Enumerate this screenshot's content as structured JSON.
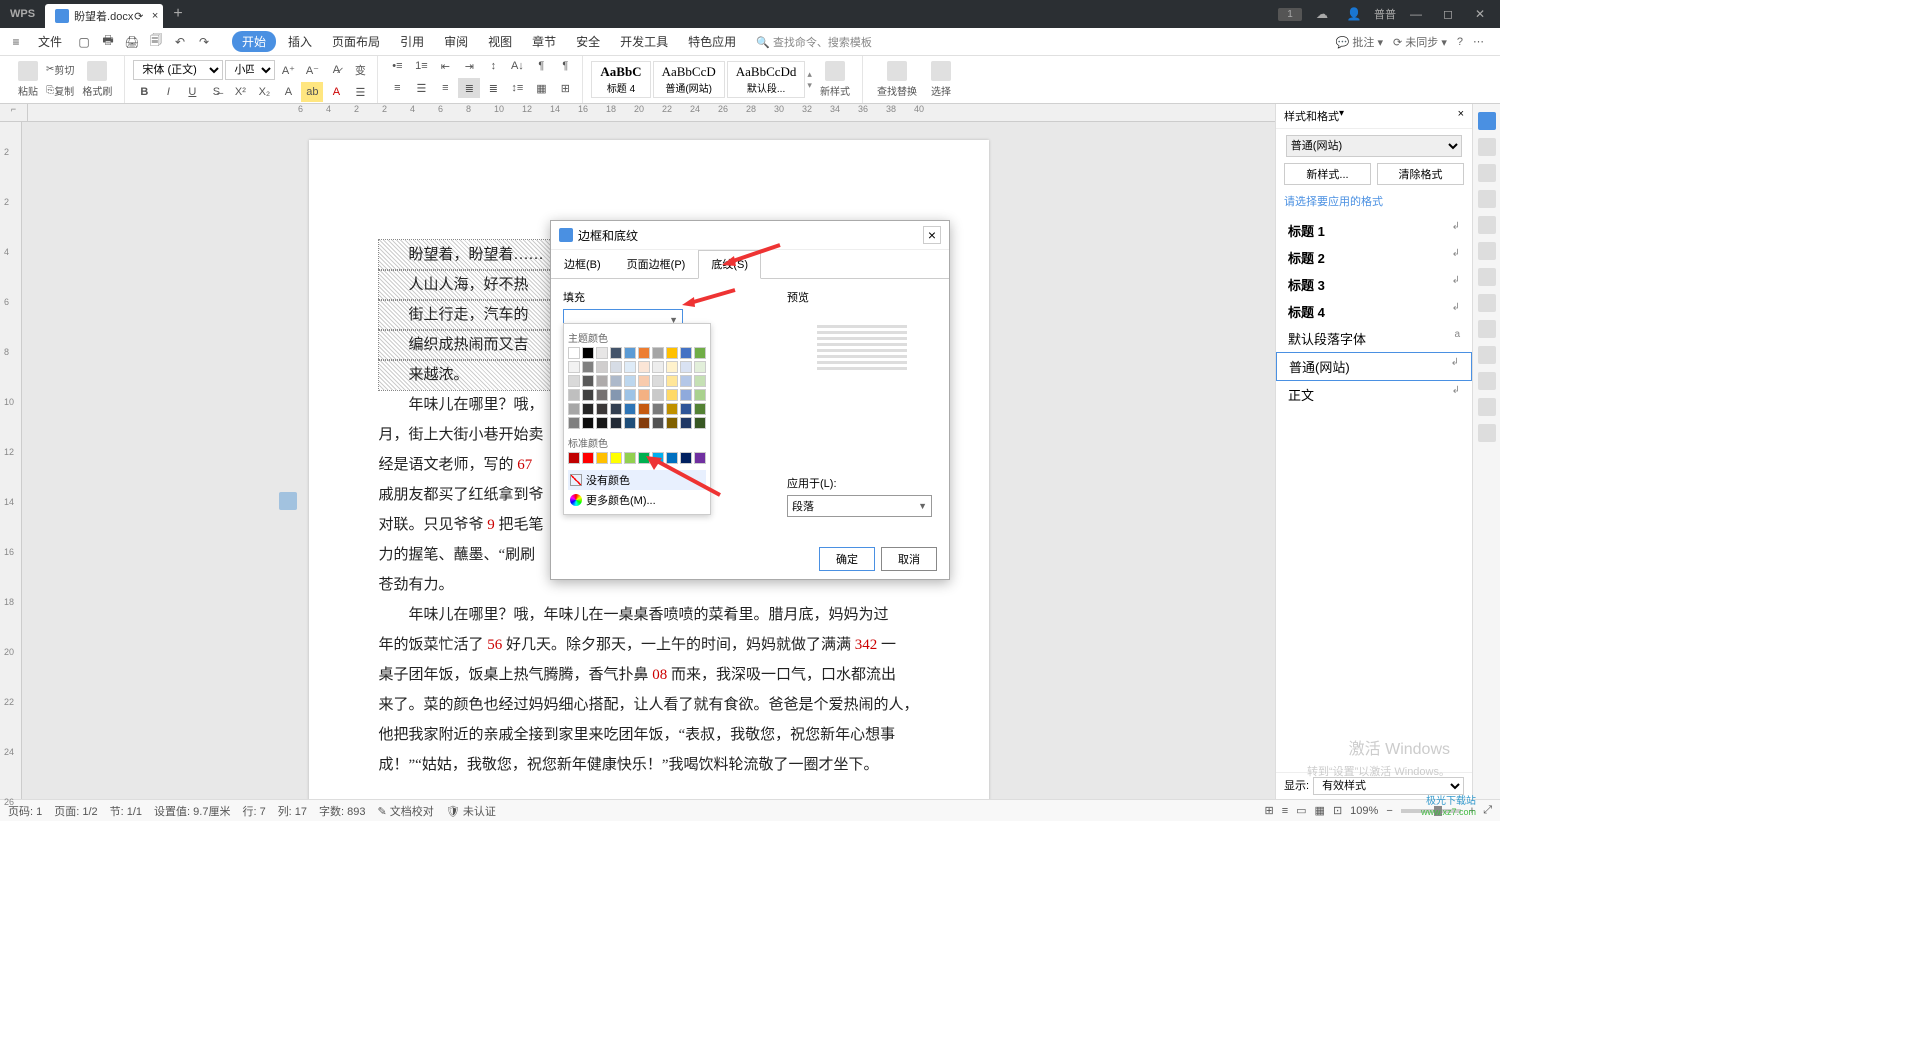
{
  "app": {
    "name": "WPS",
    "doc_title": "盼望着.docx"
  },
  "menu": {
    "file": "文件",
    "items": [
      "开始",
      "插入",
      "页面布局",
      "引用",
      "审阅",
      "视图",
      "章节",
      "安全",
      "开发工具",
      "特色应用"
    ],
    "search": "查找命令、搜索模板",
    "right": {
      "annot": "批注",
      "annotdrop": "▾",
      "sync": "未同步",
      "syncdrop": "▾",
      "help": "?",
      "menu": "⋯"
    }
  },
  "ribbon": {
    "paste": "粘贴",
    "cut": "剪切",
    "copy": "复制",
    "format": "格式刷",
    "font": "宋体 (正文)",
    "size": "小四",
    "styles": [
      {
        "preview": "AaBbC",
        "name": "标题 4",
        "bold": true
      },
      {
        "preview": "AaBbCcD",
        "name": "普通(网站)"
      },
      {
        "preview": "AaBbCcDd",
        "name": "默认段..."
      }
    ],
    "newstyle": "新样式",
    "search": "查找替换",
    "select": "选择"
  },
  "ruler_h": [
    "6",
    "4",
    "2",
    "2",
    "4",
    "6",
    "8",
    "10",
    "12",
    "14",
    "16",
    "18",
    "20",
    "22",
    "24",
    "26",
    "28",
    "30",
    "32",
    "34",
    "36",
    "38",
    "40"
  ],
  "ruler_v": [
    "2",
    "2",
    "4",
    "6",
    "8",
    "10",
    "12",
    "14",
    "16",
    "18",
    "20",
    "22",
    "24",
    "26"
  ],
  "doc": {
    "p1": "盼望着，盼望着……",
    "p1_tail": "人山人海，好不热",
    "p2": "街上行走，汽车的",
    "p3": "编织成热闹而又吉",
    "p4": "来越浓。",
    "p5a": "年味儿在哪里？哦，",
    "p5b": "月，街上大街小巷开始卖",
    "p5c": "经是语文老师，写的",
    "p5c_num": "67",
    "p5d": "戚朋友都买了红纸拿到爷",
    "p5e": "对联。只见爷爷",
    "p5e_num": "9",
    "p5e2": "把毛笔",
    "p5f": "力的握笔、蘸墨、“刷刷",
    "p5g": "苍劲有力。",
    "p6a": "年味儿在哪里？哦，年味儿在一桌桌香喷喷的菜肴里。腊月底，妈妈为过",
    "p6b": "年的饭菜忙活了",
    "p6b_num": "56",
    "p6b2": "好几天。除夕那天，一上午的时间，妈妈就做了满满",
    "p6b_num2": "342",
    "p6b3": "一",
    "p6c": "桌子团年饭，饭桌上热气腾腾，香气扑鼻",
    "p6c_num": "08",
    "p6c2": "而来，我深吸一口气，口水都流出",
    "p6d": "来了。菜的颜色也经过妈妈细心搭配，让人看了就有食欲。爸爸是个爱热闹的人，",
    "p6e": "他把我家附近的亲戚全接到家里来吃团年饭，“表叔，我敬您，祝您新年心想事",
    "p6f": "成！”“姑姑，我敬您，祝您新年健康快乐！”我喝饮料轮流敬了一圈才坐下。"
  },
  "rightpanel": {
    "title": "样式和格式",
    "close": "×",
    "current": "普通(网站)",
    "newstyle": "新样式...",
    "clear": "清除格式",
    "hint": "请选择要应用的格式",
    "styles": [
      "标题 1",
      "标题 2",
      "标题 3",
      "标题 4",
      "默认段落字体",
      "普通(网站)",
      "正文"
    ],
    "foot_label": "显示:",
    "foot_val": "有效样式"
  },
  "dialog": {
    "title": "边框和底纹",
    "tabs": [
      "边框(B)",
      "页面边框(P)",
      "底纹(S)"
    ],
    "fill_label": "填充",
    "preview_label": "预览",
    "theme": "主题颜色",
    "standard": "标准颜色",
    "theme_colors": [
      "#ffffff",
      "#000000",
      "#e7e6e6",
      "#44546a",
      "#5b9bd5",
      "#ed7d31",
      "#a5a5a5",
      "#ffc000",
      "#4472c4",
      "#70ad47",
      "#f2f2f2",
      "#808080",
      "#d0cece",
      "#d6dce5",
      "#deebf7",
      "#fbe5d6",
      "#ededed",
      "#fff2cc",
      "#d9e2f3",
      "#e2efda",
      "#d9d9d9",
      "#595959",
      "#aeabab",
      "#adb9ca",
      "#bdd7ee",
      "#f8cbad",
      "#dbdbdb",
      "#ffe699",
      "#b4c7e7",
      "#c5e0b4",
      "#bfbfbf",
      "#404040",
      "#757171",
      "#8497b0",
      "#9dc3e6",
      "#f4b183",
      "#c9c9c9",
      "#ffd966",
      "#8faadc",
      "#a9d18e",
      "#a6a6a6",
      "#262626",
      "#3b3838",
      "#333f50",
      "#2e75b6",
      "#c55a11",
      "#7b7b7b",
      "#bf9000",
      "#2f5597",
      "#548235",
      "#7f7f7f",
      "#0d0d0d",
      "#171717",
      "#222a35",
      "#1f4e79",
      "#843c0c",
      "#525252",
      "#806000",
      "#203864",
      "#385723"
    ],
    "std_colors": [
      "#c00000",
      "#ff0000",
      "#ffc000",
      "#ffff00",
      "#92d050",
      "#00b050",
      "#00b0f0",
      "#0070c0",
      "#002060",
      "#7030a0"
    ],
    "nocolor": "没有颜色",
    "morecolor": "更多颜色(M)...",
    "apply_label": "应用于(L):",
    "apply_val": "段落",
    "ok": "确定",
    "cancel": "取消"
  },
  "status": {
    "page": "页码: 1",
    "pages": "页面: 1/2",
    "sec": "节: 1/1",
    "setval": "设置值: 9.7厘米",
    "row": "行: 7",
    "col": "列: 17",
    "words": "字数: 893",
    "proof": "文档校对",
    "cert": "未认证",
    "zoom": "109%"
  },
  "user": "普普",
  "watermark": "激活 Windows",
  "watermark2": "转到“设置”以激活 Windows。",
  "wm_logo": "极光下载站",
  "wm_url": "www.xz7.com"
}
